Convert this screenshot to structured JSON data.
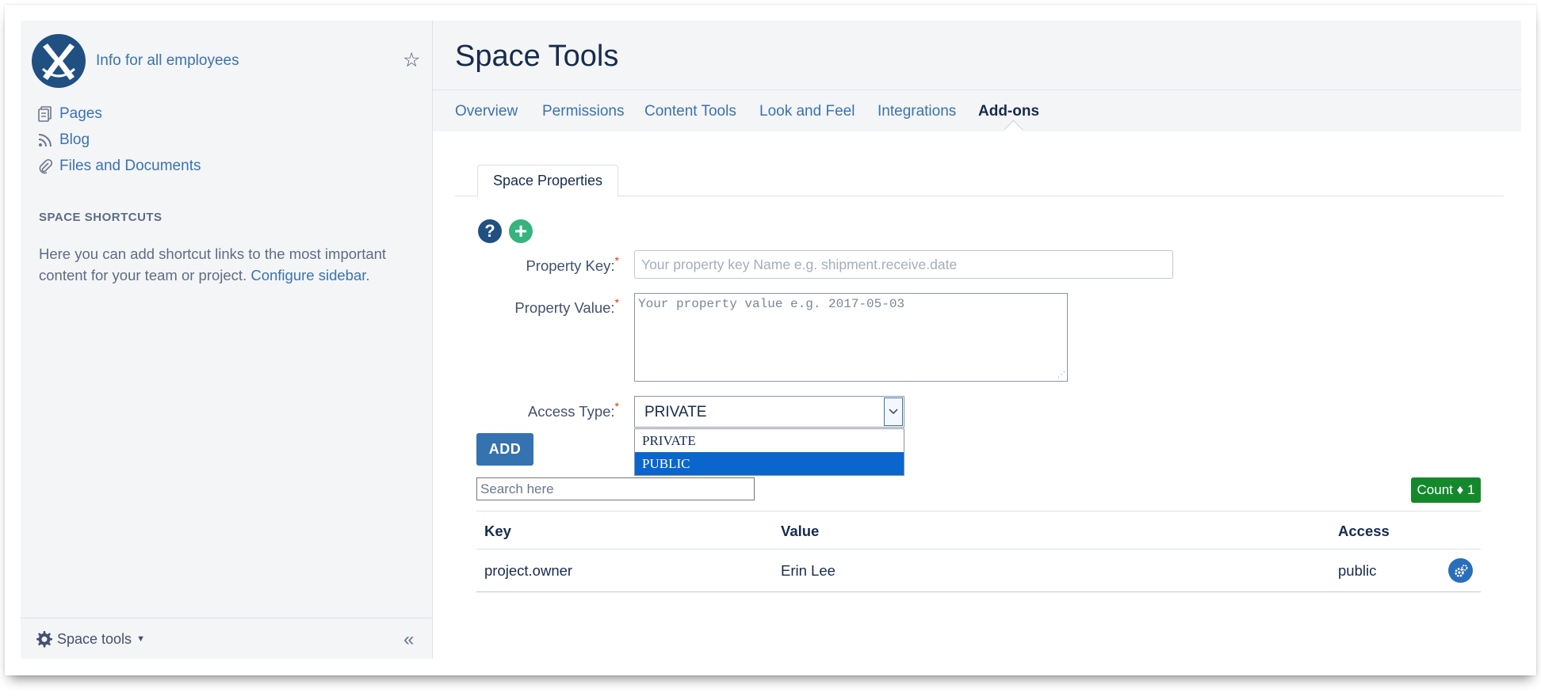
{
  "sidebar": {
    "space_name": "Info for all employees",
    "nav": [
      {
        "label": "Pages",
        "icon": "pages-icon"
      },
      {
        "label": "Blog",
        "icon": "rss-icon"
      },
      {
        "label": "Files and Documents",
        "icon": "paperclip-icon"
      }
    ],
    "shortcuts_heading": "SPACE SHORTCUTS",
    "shortcuts_text": "Here you can add shortcut links to the most important content for your team or project.",
    "configure_link": "Configure sidebar",
    "configure_suffix": ".",
    "footer_label": "Space tools",
    "collapse_glyph": "«"
  },
  "header": {
    "title": "Space Tools",
    "tabs": [
      {
        "label": "Overview",
        "active": false
      },
      {
        "label": "Permissions",
        "active": false
      },
      {
        "label": "Content Tools",
        "active": false
      },
      {
        "label": "Look and Feel",
        "active": false
      },
      {
        "label": "Integrations",
        "active": false
      },
      {
        "label": "Add-ons",
        "active": true
      }
    ]
  },
  "main": {
    "subtab": "Space Properties",
    "help_glyph": "?",
    "add_glyph": "+",
    "form": {
      "key_label": "Property Key:",
      "key_placeholder": "Your property key Name e.g. shipment.receive.date",
      "value_label": "Property Value:",
      "value_placeholder": "Your property value e.g. 2017-05-03",
      "access_label": "Access Type:",
      "access_selected": "PRIVATE",
      "access_options": [
        "PRIVATE",
        "PUBLIC"
      ],
      "required_mark": "*"
    },
    "add_button": "ADD",
    "search_placeholder": "Search here",
    "count_badge": "Count ♦ 1",
    "table": {
      "headers": [
        "Key",
        "Value",
        "Access"
      ],
      "rows": [
        {
          "key": "project.owner",
          "value": "Erin Lee",
          "access": "public"
        }
      ]
    }
  },
  "colors": {
    "link": "#3b73af",
    "primary_button": "#3572b0",
    "count_badge": "#14892c",
    "selected_option": "#0a66cc",
    "logo_bg": "#205081"
  }
}
